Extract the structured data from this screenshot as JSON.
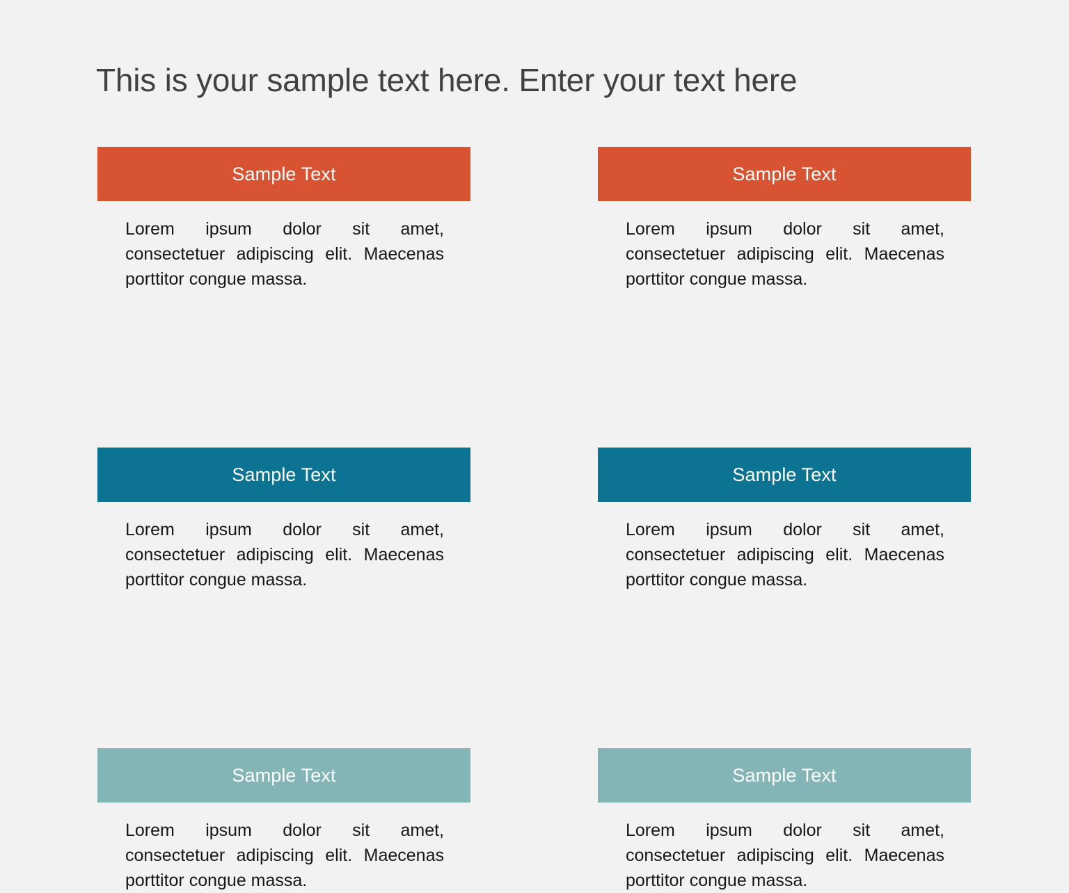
{
  "slide": {
    "background_color": "#f2f2f2",
    "title": "This is your sample text here. Enter your text here",
    "title_color": "#414141"
  },
  "palette": {
    "orange": "#d75332",
    "blue": "#0c7492",
    "teal": "#83b5b7",
    "header_label_color": "#ffffff",
    "body_text_color": "#161616"
  },
  "cards": [
    {
      "id": "card-1",
      "row": 1,
      "column": "left",
      "header_label": "Sample Text",
      "header_color": "#d75332",
      "body_text": "Lorem ipsum dolor sit amet, consectetuer adipiscing elit. Maecenas porttitor congue massa."
    },
    {
      "id": "card-2",
      "row": 1,
      "column": "right",
      "header_label": "Sample Text",
      "header_color": "#d75332",
      "body_text": "Lorem ipsum dolor sit amet, consectetuer adipiscing elit. Maecenas porttitor congue massa."
    },
    {
      "id": "card-3",
      "row": 2,
      "column": "left",
      "header_label": "Sample Text",
      "header_color": "#0c7492",
      "body_text": "Lorem ipsum dolor sit amet, consectetuer adipiscing elit. Maecenas porttitor congue massa."
    },
    {
      "id": "card-4",
      "row": 2,
      "column": "right",
      "header_label": "Sample Text",
      "header_color": "#0c7492",
      "body_text": "Lorem ipsum dolor sit amet, consectetuer adipiscing elit. Maecenas porttitor congue massa."
    },
    {
      "id": "card-5",
      "row": 3,
      "column": "left",
      "header_label": "Sample Text",
      "header_color": "#83b5b7",
      "body_text": "Lorem ipsum dolor sit amet, consectetuer adipiscing elit. Maecenas porttitor congue massa."
    },
    {
      "id": "card-6",
      "row": 3,
      "column": "right",
      "header_label": "Sample Text",
      "header_color": "#83b5b7",
      "body_text": "Lorem ipsum dolor sit amet, consectetuer adipiscing elit. Maecenas porttitor congue massa."
    }
  ]
}
